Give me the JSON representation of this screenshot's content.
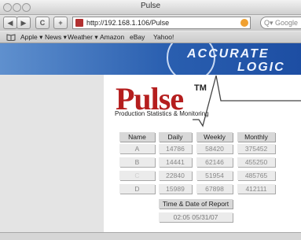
{
  "window": {
    "title": "Pulse"
  },
  "toolbar": {
    "back": "◀",
    "forward": "▶",
    "reload": "C",
    "add": "+",
    "url": "http://192.168.1.106/Pulse",
    "search_placeholder": "Q▾ Google"
  },
  "bookmarks": {
    "icon": "book-icon",
    "items": [
      "Apple ▾",
      "News ▾",
      "Weather ▾",
      "Amazon",
      "eBay",
      "Yahoo!"
    ]
  },
  "banner": {
    "logo_top": "ACCURATE",
    "logo_bottom": "LOGIC"
  },
  "app": {
    "brand": "Pulse",
    "tm": "TM",
    "subtitle": "Production Statistics & Monitoring"
  },
  "table": {
    "headers": [
      "Name",
      "Daily",
      "Weekly",
      "Monthly"
    ],
    "rows": [
      [
        "A",
        "14786",
        "58420",
        "375452"
      ],
      [
        "B",
        "14441",
        "62146",
        "455250"
      ],
      [
        "C",
        "22840",
        "51954",
        "485765"
      ],
      [
        "D",
        "15989",
        "67898",
        "412111"
      ]
    ]
  },
  "report": {
    "label": "Time & Date of Report",
    "value": "02:05 05/31/07"
  }
}
